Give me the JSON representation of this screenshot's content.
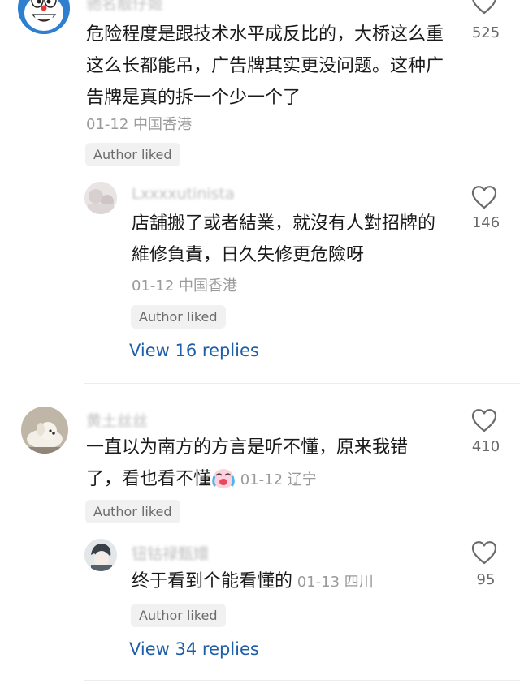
{
  "comments": [
    {
      "name": "驰名靓仔姬",
      "text": "危险程度是跟技术水平成反比的，大桥这么重这么长都能吊，广告牌其实更没问题。这种广告牌是真的拆一个少一个了",
      "date": "01-12",
      "location": "中国香港",
      "author_liked": "Author liked",
      "likes": "525",
      "avatar_icon": "doraemon-avatar",
      "reply": {
        "name": "Lxxxxutinista",
        "text": "店舖搬了或者結業，就沒有人對招牌的維修負責，日久失修更危險呀",
        "date": "01-12",
        "location": "中国香港",
        "author_liked": "Author liked",
        "likes": "146"
      },
      "view_replies": "View 16 replies"
    },
    {
      "name": "黄土丝丝",
      "text_line1": "一直以为南方的方言是听不懂，原来我错",
      "text_line2": "了，看也看不懂",
      "emoji_icon": "crying-laughing-emoji",
      "date": "01-12",
      "location": "辽宁",
      "author_liked": "Author liked",
      "likes": "410",
      "reply": {
        "name": "钮钴禄甄嬛",
        "text": "终于看到个能看懂的",
        "date": "01-13",
        "location": "四川",
        "author_liked": "Author liked",
        "likes": "95"
      },
      "view_replies": "View 34 replies"
    }
  ],
  "colors": {
    "link": "#1f5fa7",
    "meta": "#9a9a9a",
    "badge_bg": "#f1f1f1"
  }
}
